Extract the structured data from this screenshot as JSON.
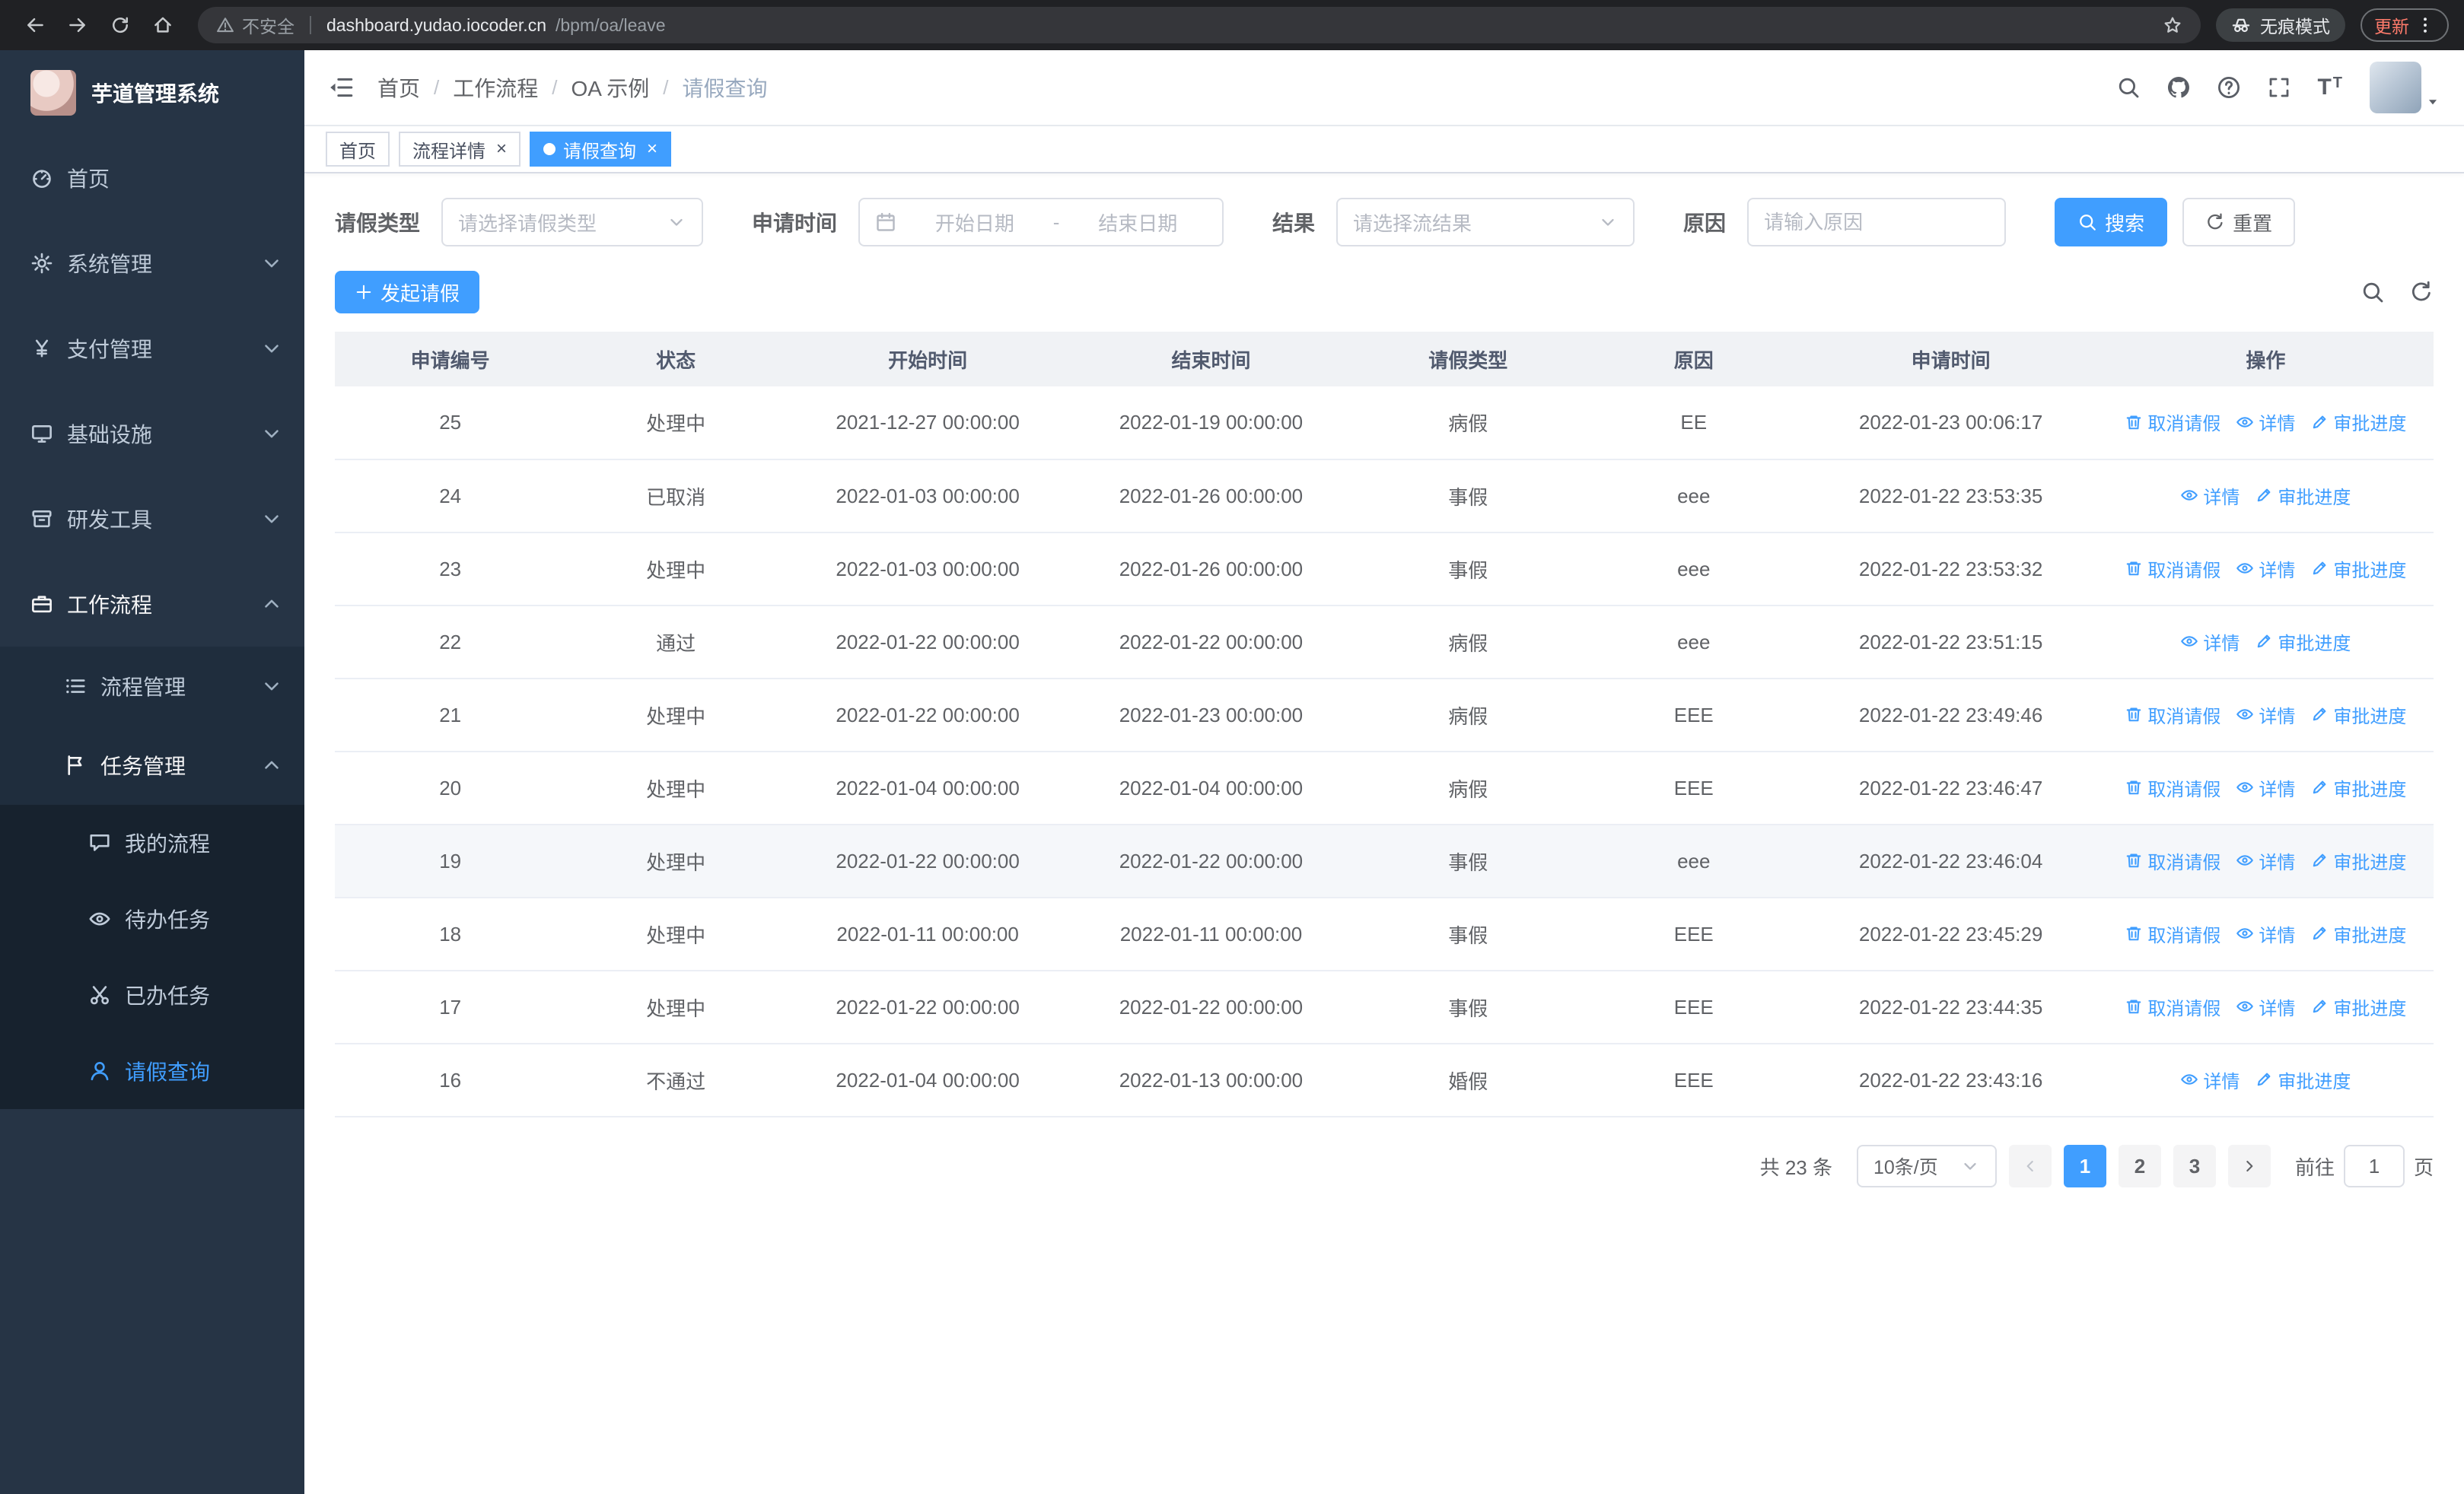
{
  "browser": {
    "security_label": "不安全",
    "url_host": "dashboard.yudao.iocoder.cn",
    "url_path": "/bpm/oa/leave",
    "incognito_label": "无痕模式",
    "update_label": "更新"
  },
  "sidebar": {
    "logo_title": "芋道管理系统",
    "items": [
      {
        "key": "home",
        "label": "首页",
        "icon": "dashboard",
        "level": 1
      },
      {
        "key": "system-management",
        "label": "系统管理",
        "icon": "gear",
        "level": 1,
        "chevron": "down"
      },
      {
        "key": "payment-management",
        "label": "支付管理",
        "icon": "yen",
        "level": 1,
        "chevron": "down"
      },
      {
        "key": "infrastructure",
        "label": "基础设施",
        "icon": "monitor",
        "level": 1,
        "chevron": "down"
      },
      {
        "key": "dev-tools",
        "label": "研发工具",
        "icon": "toolbox",
        "level": 1,
        "chevron": "down"
      },
      {
        "key": "workflow",
        "label": "工作流程",
        "icon": "briefcase",
        "level": 1,
        "chevron": "up",
        "trail": true
      },
      {
        "key": "process-management",
        "label": "流程管理",
        "icon": "list",
        "level": 2,
        "chevron": "down"
      },
      {
        "key": "task-management",
        "label": "任务管理",
        "icon": "flag",
        "level": 2,
        "chevron": "up",
        "trail": true
      },
      {
        "key": "my-process",
        "label": "我的流程",
        "icon": "chat",
        "level": 3
      },
      {
        "key": "todo-task",
        "label": "待办任务",
        "icon": "eye",
        "level": 3
      },
      {
        "key": "done-task",
        "label": "已办任务",
        "icon": "scissors",
        "level": 3
      },
      {
        "key": "leave-query",
        "label": "请假查询",
        "icon": "user",
        "level": 3,
        "active": true
      }
    ]
  },
  "header": {
    "breadcrumb": [
      "首页",
      "工作流程",
      "OA 示例",
      "请假查询"
    ]
  },
  "tabs": [
    {
      "key": "home",
      "label": "首页",
      "closable": false,
      "active": false
    },
    {
      "key": "process-detail",
      "label": "流程详情",
      "closable": true,
      "active": false
    },
    {
      "key": "leave-query",
      "label": "请假查询",
      "closable": true,
      "active": true
    }
  ],
  "filters": {
    "leave_type_label": "请假类型",
    "leave_type_placeholder": "请选择请假类型",
    "apply_time_label": "申请时间",
    "start_date_placeholder": "开始日期",
    "range_separator": "-",
    "end_date_placeholder": "结束日期",
    "result_label": "结果",
    "result_placeholder": "请选择流结果",
    "reason_label": "原因",
    "reason_placeholder": "请输入原因",
    "search_button": "搜索",
    "reset_button": "重置"
  },
  "toolbar": {
    "create_button": "发起请假"
  },
  "table": {
    "columns": [
      "申请编号",
      "状态",
      "开始时间",
      "结束时间",
      "请假类型",
      "原因",
      "申请时间",
      "操作"
    ],
    "column_keys": [
      "request-id",
      "status",
      "start-time",
      "end-time",
      "leave-type",
      "reason",
      "apply-time",
      "actions"
    ],
    "action_labels": {
      "cancel": "取消请假",
      "detail": "详情",
      "progress": "审批进度"
    },
    "rows": [
      {
        "id": "25",
        "status": "处理中",
        "start": "2021-12-27 00:00:00",
        "end": "2022-01-19 00:00:00",
        "type": "病假",
        "reason": "EE",
        "applied": "2022-01-23 00:06:17",
        "cancelable": true
      },
      {
        "id": "24",
        "status": "已取消",
        "start": "2022-01-03 00:00:00",
        "end": "2022-01-26 00:00:00",
        "type": "事假",
        "reason": "eee",
        "applied": "2022-01-22 23:53:35",
        "cancelable": false
      },
      {
        "id": "23",
        "status": "处理中",
        "start": "2022-01-03 00:00:00",
        "end": "2022-01-26 00:00:00",
        "type": "事假",
        "reason": "eee",
        "applied": "2022-01-22 23:53:32",
        "cancelable": true
      },
      {
        "id": "22",
        "status": "通过",
        "start": "2022-01-22 00:00:00",
        "end": "2022-01-22 00:00:00",
        "type": "病假",
        "reason": "eee",
        "applied": "2022-01-22 23:51:15",
        "cancelable": false
      },
      {
        "id": "21",
        "status": "处理中",
        "start": "2022-01-22 00:00:00",
        "end": "2022-01-23 00:00:00",
        "type": "病假",
        "reason": "EEE",
        "applied": "2022-01-22 23:49:46",
        "cancelable": true
      },
      {
        "id": "20",
        "status": "处理中",
        "start": "2022-01-04 00:00:00",
        "end": "2022-01-04 00:00:00",
        "type": "病假",
        "reason": "EEE",
        "applied": "2022-01-22 23:46:47",
        "cancelable": true
      },
      {
        "id": "19",
        "status": "处理中",
        "start": "2022-01-22 00:00:00",
        "end": "2022-01-22 00:00:00",
        "type": "事假",
        "reason": "eee",
        "applied": "2022-01-22 23:46:04",
        "cancelable": true,
        "highlighted": true
      },
      {
        "id": "18",
        "status": "处理中",
        "start": "2022-01-11 00:00:00",
        "end": "2022-01-11 00:00:00",
        "type": "事假",
        "reason": "EEE",
        "applied": "2022-01-22 23:45:29",
        "cancelable": true
      },
      {
        "id": "17",
        "status": "处理中",
        "start": "2022-01-22 00:00:00",
        "end": "2022-01-22 00:00:00",
        "type": "事假",
        "reason": "EEE",
        "applied": "2022-01-22 23:44:35",
        "cancelable": true
      },
      {
        "id": "16",
        "status": "不通过",
        "start": "2022-01-04 00:00:00",
        "end": "2022-01-13 00:00:00",
        "type": "婚假",
        "reason": "EEE",
        "applied": "2022-01-22 23:43:16",
        "cancelable": false
      }
    ]
  },
  "pagination": {
    "total_label": "共 23 条",
    "page_size_label": "10条/页",
    "pages": [
      "1",
      "2",
      "3"
    ],
    "active_page": "1",
    "goto_label": "前往",
    "goto_value": "1",
    "page_unit_label": "页"
  },
  "colors": {
    "primary": "#409eff",
    "sidebar_bg": "#263445",
    "submenu_bg": "#1f2d3d",
    "active_tab": "#409eff"
  }
}
